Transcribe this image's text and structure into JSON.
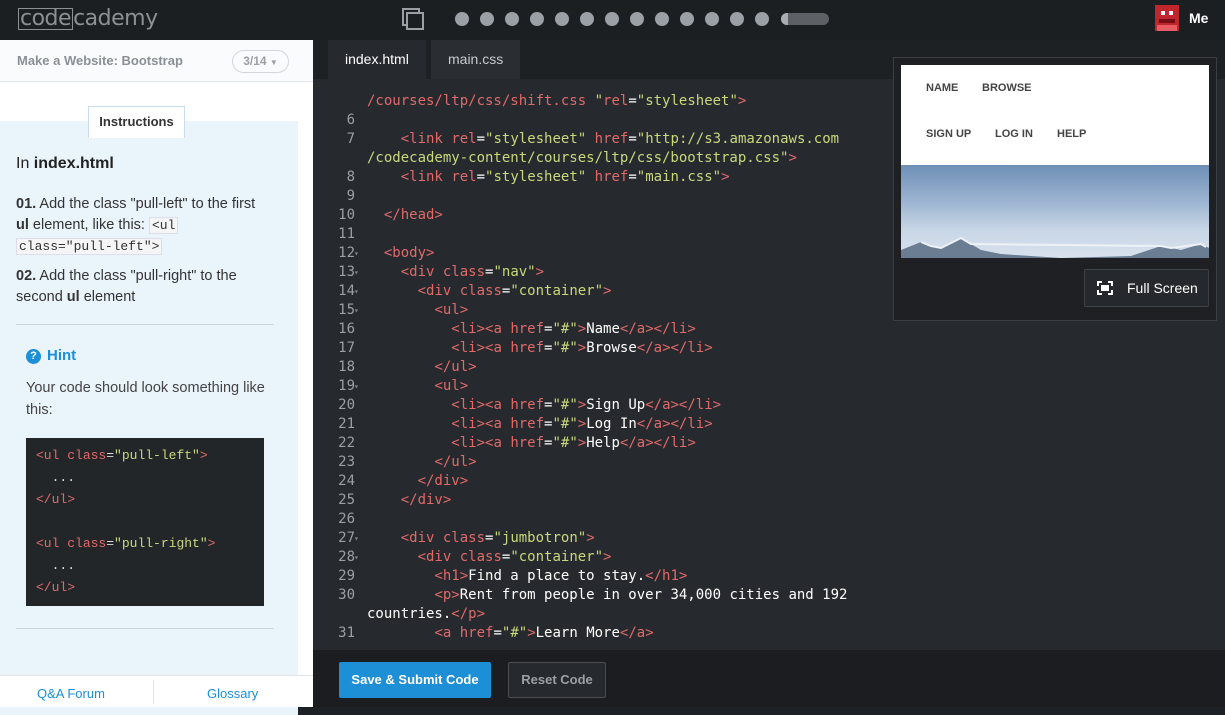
{
  "topbar": {
    "logo_left": "code",
    "logo_right": "cademy",
    "progress_dots": 14,
    "progress_fraction": 0.15,
    "user_label": "Me"
  },
  "lesson": {
    "title": "Make a Website: Bootstrap",
    "step_counter": "3/14",
    "instructions_tab": "Instructions",
    "file_intro": "In ",
    "file_name": "index.html",
    "step1_num": "01.",
    "step1_a": " Add the class \"pull-left\" to the first ",
    "step1_b": "ul",
    "step1_c": " element, like this: ",
    "step1_code_a": "<ul",
    "step1_code_b": "class=\"pull-left\">",
    "step2_num": "02.",
    "step2_a": " Add the class \"pull-right\" to the second ",
    "step2_b": "ul",
    "step2_c": " element",
    "hint_label": "Hint",
    "hint_text": "Your code should look something like this:"
  },
  "footer_links": {
    "qa": "Q&A Forum",
    "glossary": "Glossary"
  },
  "editor": {
    "tabs": [
      "index.html",
      "main.css"
    ],
    "save_label": "Save & Submit Code",
    "reset_label": "Reset Code",
    "fullscreen_label": "Full Screen"
  },
  "preview": {
    "nav_row1": [
      "NAME",
      "BROWSE"
    ],
    "nav_row2": [
      "SIGN UP",
      "LOG IN",
      "HELP"
    ]
  },
  "colors": {
    "accent": "#1c8fd7",
    "tag": "#e06a6a",
    "string": "#c7d97c"
  }
}
